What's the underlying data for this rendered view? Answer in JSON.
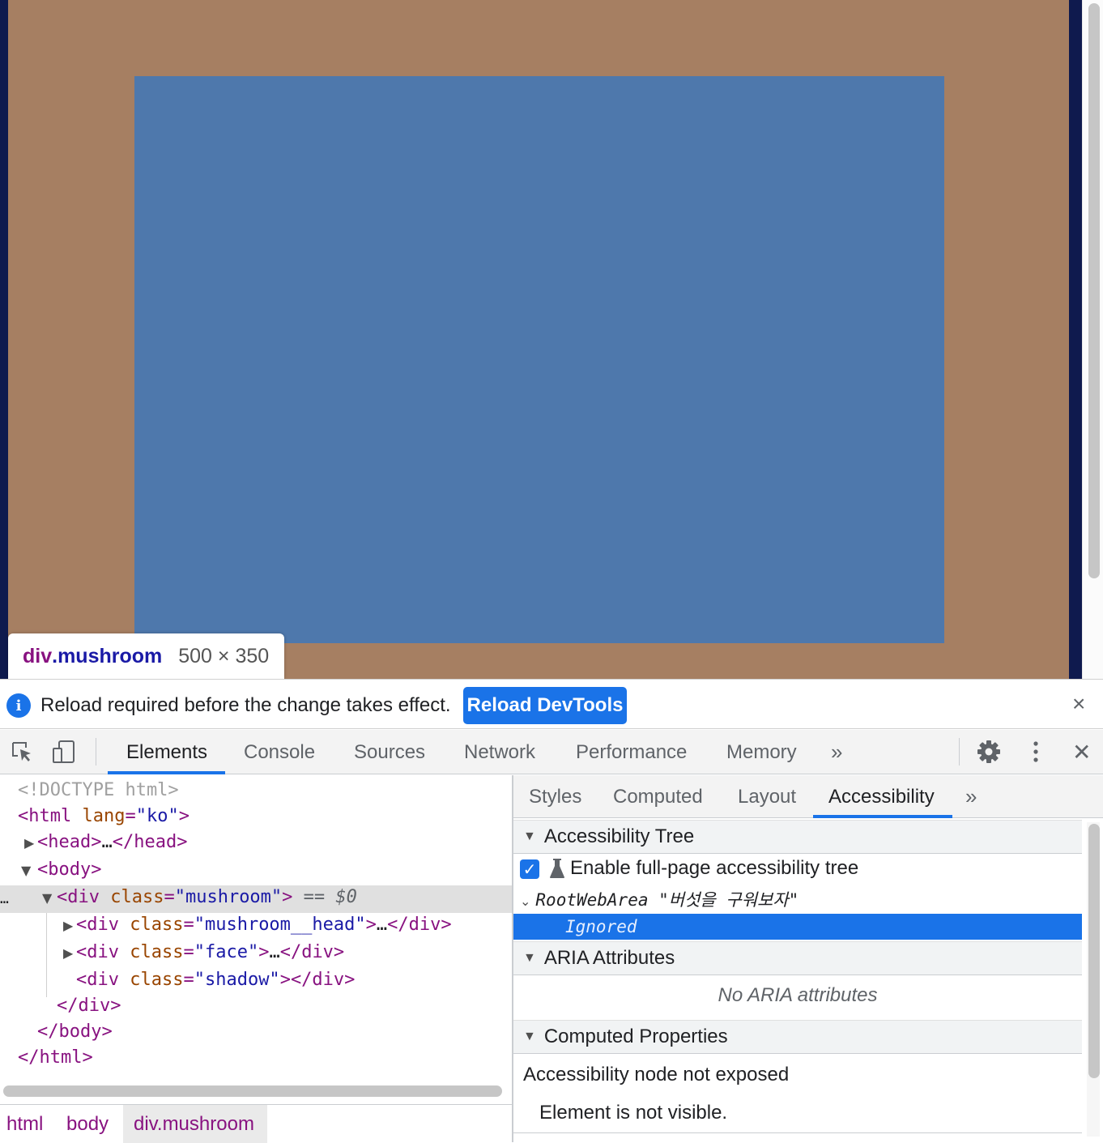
{
  "tooltip": {
    "tag": "div",
    "class": ".mushroom",
    "size": "500 × 350"
  },
  "infobar": {
    "message": "Reload required before the change takes effect.",
    "button": "Reload DevTools",
    "close": "×"
  },
  "toolbar": {
    "tabs": [
      "Elements",
      "Console",
      "Sources",
      "Network",
      "Performance",
      "Memory"
    ],
    "more": "»",
    "active_tab": "Elements",
    "close": "✕"
  },
  "dom": {
    "doctype": "<!DOCTYPE html>",
    "html_open_tag": "<html",
    "html_attr": "lang",
    "html_attr_val": "\"ko\"",
    "head": "<head>",
    "head_ellipsis": "…",
    "head_close": "</head>",
    "body_open": "<body>",
    "dots": "…",
    "div_open": "<div",
    "class_attr": "class",
    "mushroom_val": "\"mushroom\"",
    "selected_marker": "== $0",
    "head_child_val": "\"mushroom__head\"",
    "face_val": "\"face\"",
    "shadow_val": "\"shadow\"",
    "div_close": "</div>",
    "body_close": "</body>",
    "html_close": "</html>",
    "ellipsis": "…"
  },
  "breadcrumb": [
    "html",
    "body",
    "div.mushroom"
  ],
  "sidebar": {
    "tabs": [
      "Styles",
      "Computed",
      "Layout",
      "Accessibility"
    ],
    "more": "»",
    "active_tab": "Accessibility",
    "tree_header": "Accessibility Tree",
    "enable_label": "Enable full-page accessibility tree",
    "enable_checked": true,
    "root_web_area": "RootWebArea",
    "root_name": "\"버섯을 구워보자\"",
    "ignored": "Ignored",
    "aria_header": "ARIA Attributes",
    "no_aria": "No ARIA attributes",
    "computed_header": "Computed Properties",
    "not_exposed": "Accessibility node not exposed",
    "not_visible": "Element is not visible."
  },
  "colors": {
    "margin_highlight": "#a67f62",
    "content_highlight": "#4e78ac",
    "accent": "#1a73e8",
    "tag": "#881280",
    "attr": "#994500",
    "value": "#1a1aa6"
  }
}
